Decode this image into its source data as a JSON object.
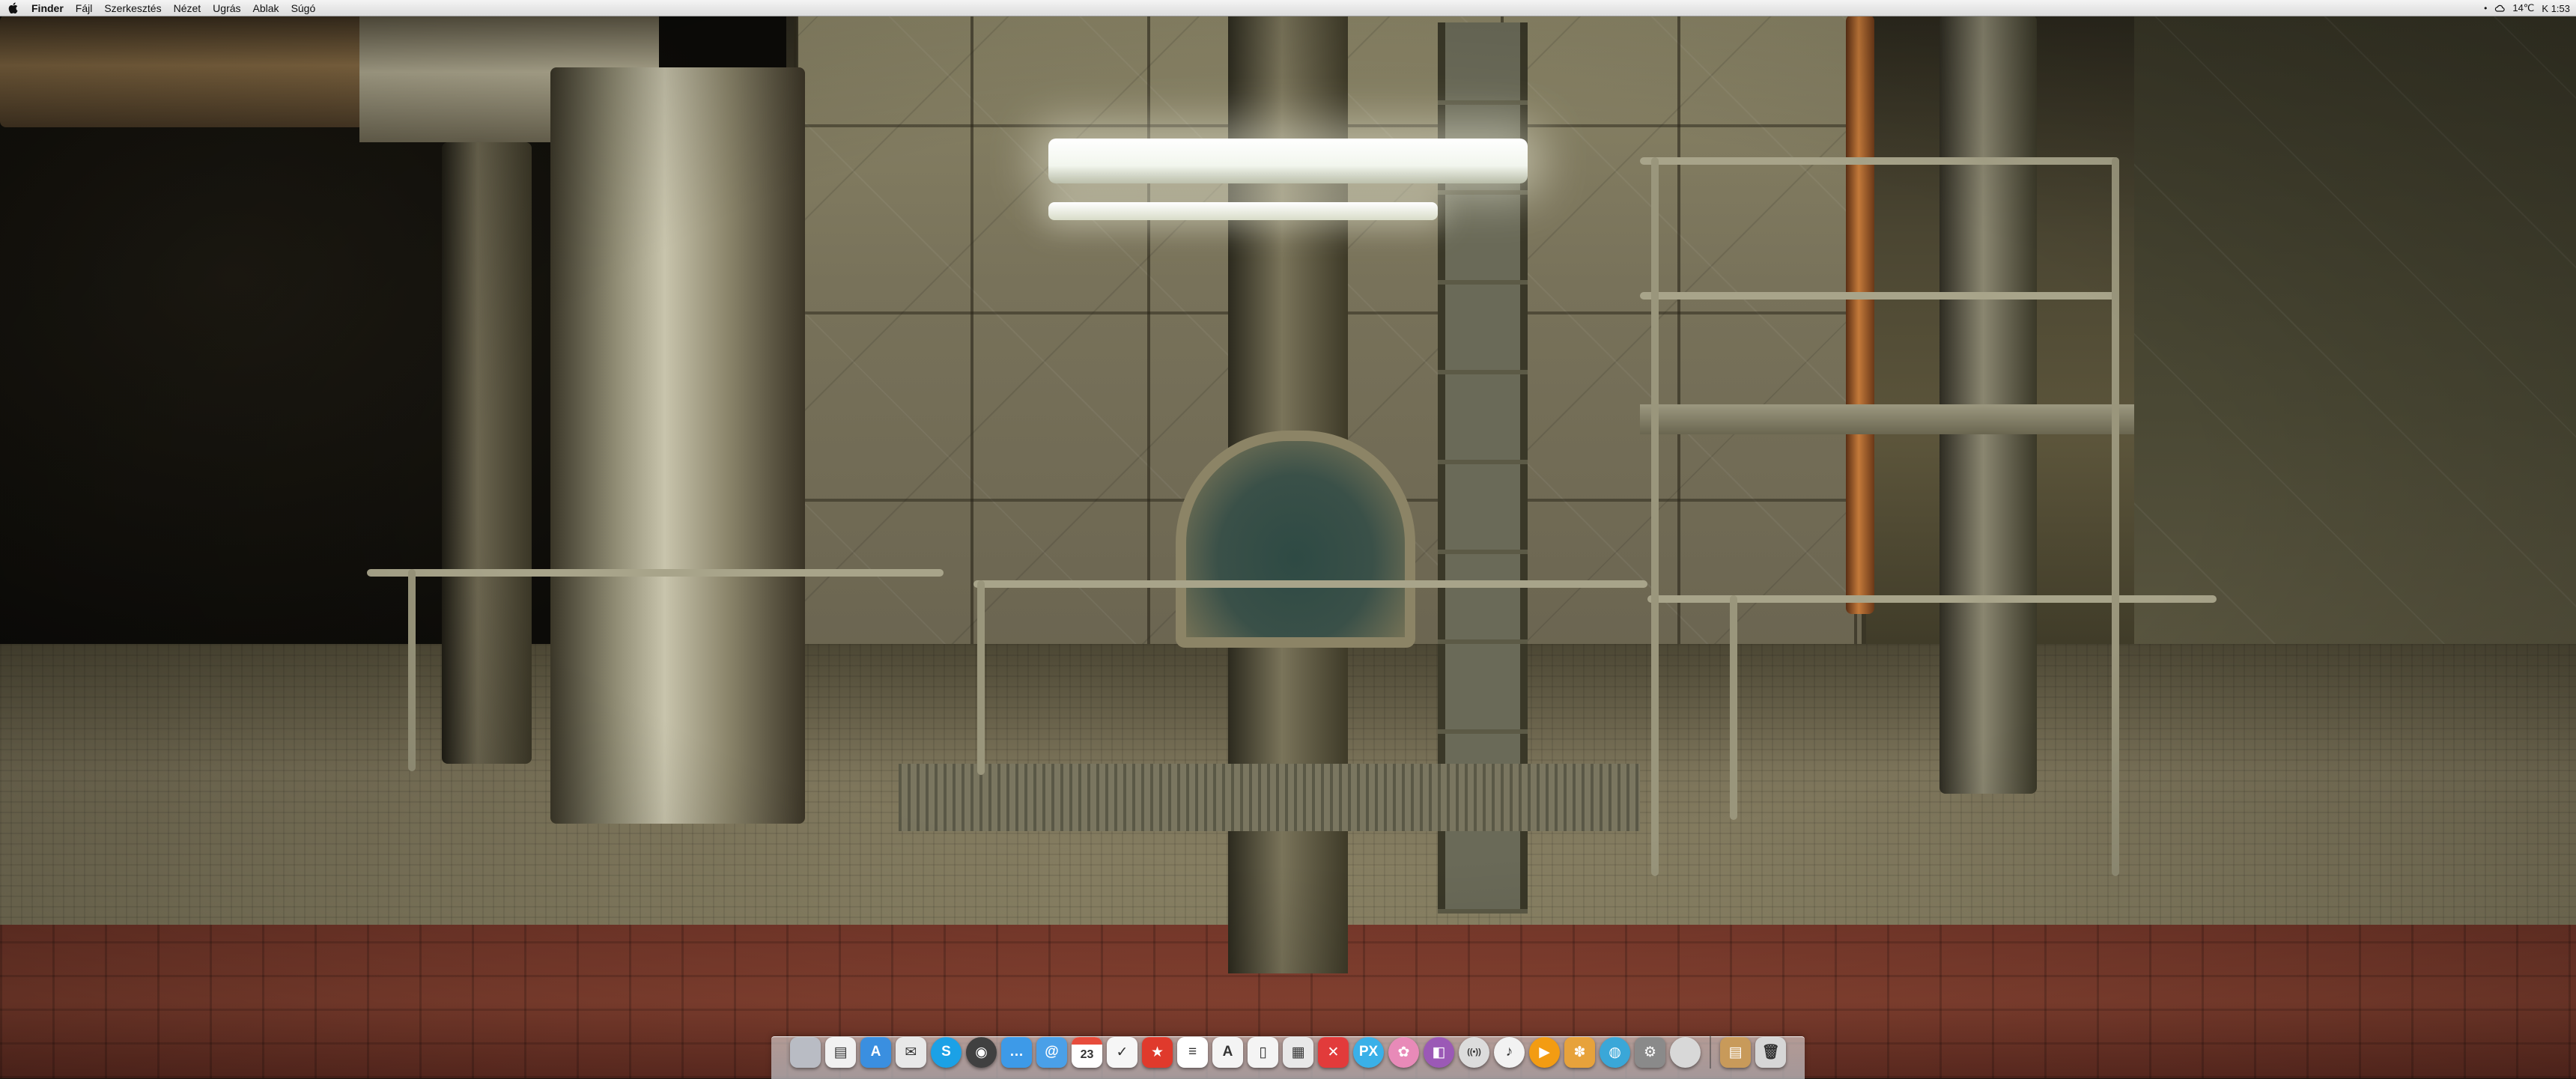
{
  "menubar": {
    "app_name": "Finder",
    "items": [
      "Fájl",
      "Szerkesztés",
      "Nézet",
      "Ugrás",
      "Ablak",
      "Súgó"
    ],
    "status": {
      "bullet": "•",
      "temperature": "14℃",
      "clock": "K 1:53"
    }
  },
  "dock": {
    "apps": [
      {
        "name": "finder-icon",
        "glyph": "",
        "color": "#b9bcc4"
      },
      {
        "name": "preview-icon",
        "glyph": "▤",
        "color": "#f1f1f1"
      },
      {
        "name": "app-store-icon",
        "glyph": "A",
        "color": "#3a8fe0"
      },
      {
        "name": "mail-icon",
        "glyph": "✉",
        "color": "#e8e8e8"
      },
      {
        "name": "skype-icon",
        "glyph": "S",
        "color": "#1ba1e6"
      },
      {
        "name": "camera-icon",
        "glyph": "◉",
        "color": "#404040"
      },
      {
        "name": "messages-icon",
        "glyph": "…",
        "color": "#3d9ae8"
      },
      {
        "name": "contacts-icon",
        "glyph": "@",
        "color": "#4aa0e8"
      },
      {
        "name": "calendar-icon",
        "glyph": "23",
        "color": "#ffffff"
      },
      {
        "name": "reminders-icon",
        "glyph": "✓",
        "color": "#f6f6f6"
      },
      {
        "name": "wunderlist-icon",
        "glyph": "★",
        "color": "#e03a2c"
      },
      {
        "name": "notes-list-icon",
        "glyph": "≡",
        "color": "#ffffff"
      },
      {
        "name": "document-icon",
        "glyph": "A",
        "color": "#f4f4f4"
      },
      {
        "name": "page-icon",
        "glyph": "▯",
        "color": "#f4f4f4"
      },
      {
        "name": "qr-icon",
        "glyph": "▦",
        "color": "#e8e8e8"
      },
      {
        "name": "chat-icon",
        "glyph": "✕",
        "color": "#e23b3b"
      },
      {
        "name": "pixelmator-icon",
        "glyph": "PX",
        "color": "#3ab0e8"
      },
      {
        "name": "flower-icon",
        "glyph": "✿",
        "color": "#e88ab8"
      },
      {
        "name": "color-picker-icon",
        "glyph": "◧",
        "color": "#9b59b6"
      },
      {
        "name": "wifi-icon",
        "glyph": "((•))",
        "color": "#dcdcdc"
      },
      {
        "name": "itunes-icon",
        "glyph": "♪",
        "color": "#f2f2f2"
      },
      {
        "name": "play-icon",
        "glyph": "▶",
        "color": "#f39c12"
      },
      {
        "name": "photos-icon",
        "glyph": "✽",
        "color": "#e7a23b"
      },
      {
        "name": "globe-icon",
        "glyph": "◍",
        "color": "#3aa7d8"
      },
      {
        "name": "system-preferences-icon",
        "glyph": "⚙",
        "color": "#8a8a8a"
      },
      {
        "name": "apple-icon",
        "glyph": "",
        "color": "#d8d8d8"
      }
    ],
    "docs": [
      {
        "name": "downloads-stack-icon",
        "glyph": "▤",
        "color": "#c89a5a"
      },
      {
        "name": "trash-icon",
        "glyph": "🗑",
        "color": "#d6d6d6"
      }
    ]
  },
  "wallpaper": {
    "description_colors": {
      "wall": "#78725a",
      "floor_red": "#8e4634",
      "lamp": "#f2f6ee"
    }
  }
}
